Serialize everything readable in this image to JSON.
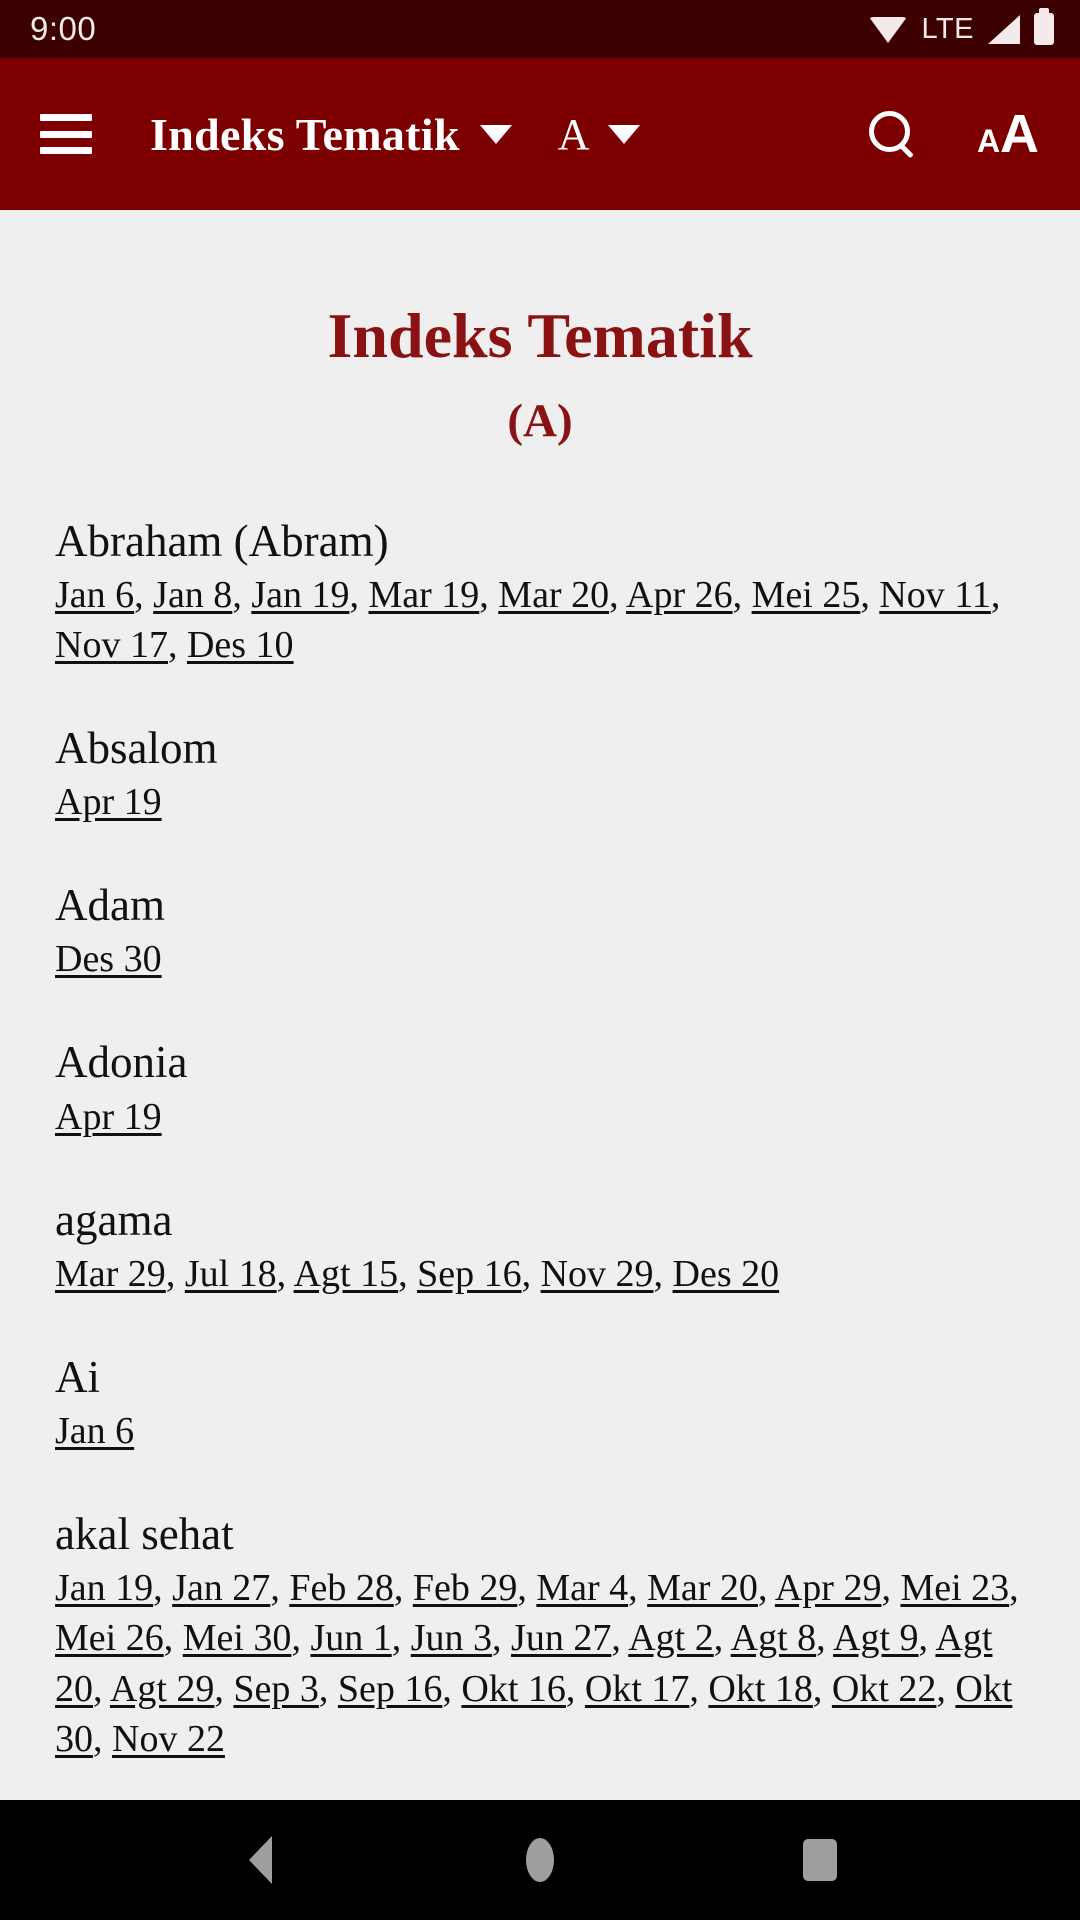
{
  "status_bar": {
    "time": "9:00",
    "network_label": "LTE",
    "icons": [
      "wifi-icon",
      "signal-icon",
      "battery-icon"
    ]
  },
  "app_bar": {
    "menu_icon": "hamburger-menu-icon",
    "title": "Indeks Tematik",
    "title_caret": "chevron-down-icon",
    "letter_filter": "A",
    "letter_caret": "chevron-down-icon",
    "search_icon": "search-icon",
    "text_size_icon": "text-size-icon",
    "text_size_small": "A",
    "text_size_big": "A",
    "background_color": "#7d0000"
  },
  "page": {
    "title": "Indeks Tematik",
    "subtitle": "(A)",
    "accent_color": "#8b1212",
    "background_color": "#efefef"
  },
  "entries": [
    {
      "term": "Abraham (Abram)",
      "refs": [
        "Jan 6",
        "Jan 8",
        "Jan 19",
        "Mar 19",
        "Mar 20",
        "Apr 26",
        "Mei 25",
        "Nov 11",
        "Nov 17",
        "Des 10"
      ]
    },
    {
      "term": "Absalom",
      "refs": [
        "Apr 19"
      ]
    },
    {
      "term": "Adam",
      "refs": [
        "Des 30"
      ]
    },
    {
      "term": "Adonia",
      "refs": [
        "Apr 19"
      ]
    },
    {
      "term": "agama",
      "refs": [
        "Mar 29",
        "Jul 18",
        "Agt 15",
        "Sep 16",
        "Nov 29",
        "Des 20"
      ]
    },
    {
      "term": "Ai",
      "refs": [
        "Jan 6"
      ]
    },
    {
      "term": "akal sehat",
      "refs": [
        "Jan 19",
        "Jan 27",
        "Feb 28",
        "Feb 29",
        "Mar 4",
        "Mar 20",
        "Apr 29",
        "Mei 23",
        "Mei 26",
        "Mei 30",
        "Jun 1",
        "Jun 3",
        "Jun 27",
        "Agt 2",
        "Agt 8",
        "Agt 9",
        "Agt 20",
        "Agt 29",
        "Sep 3",
        "Sep 16",
        "Okt 16",
        "Okt 17",
        "Okt 18",
        "Okt 22",
        "Okt 30",
        "Nov 22"
      ]
    }
  ],
  "nav_bar": {
    "back": "back-triangle-icon",
    "home": "home-circle-icon",
    "recents": "recents-square-icon"
  }
}
